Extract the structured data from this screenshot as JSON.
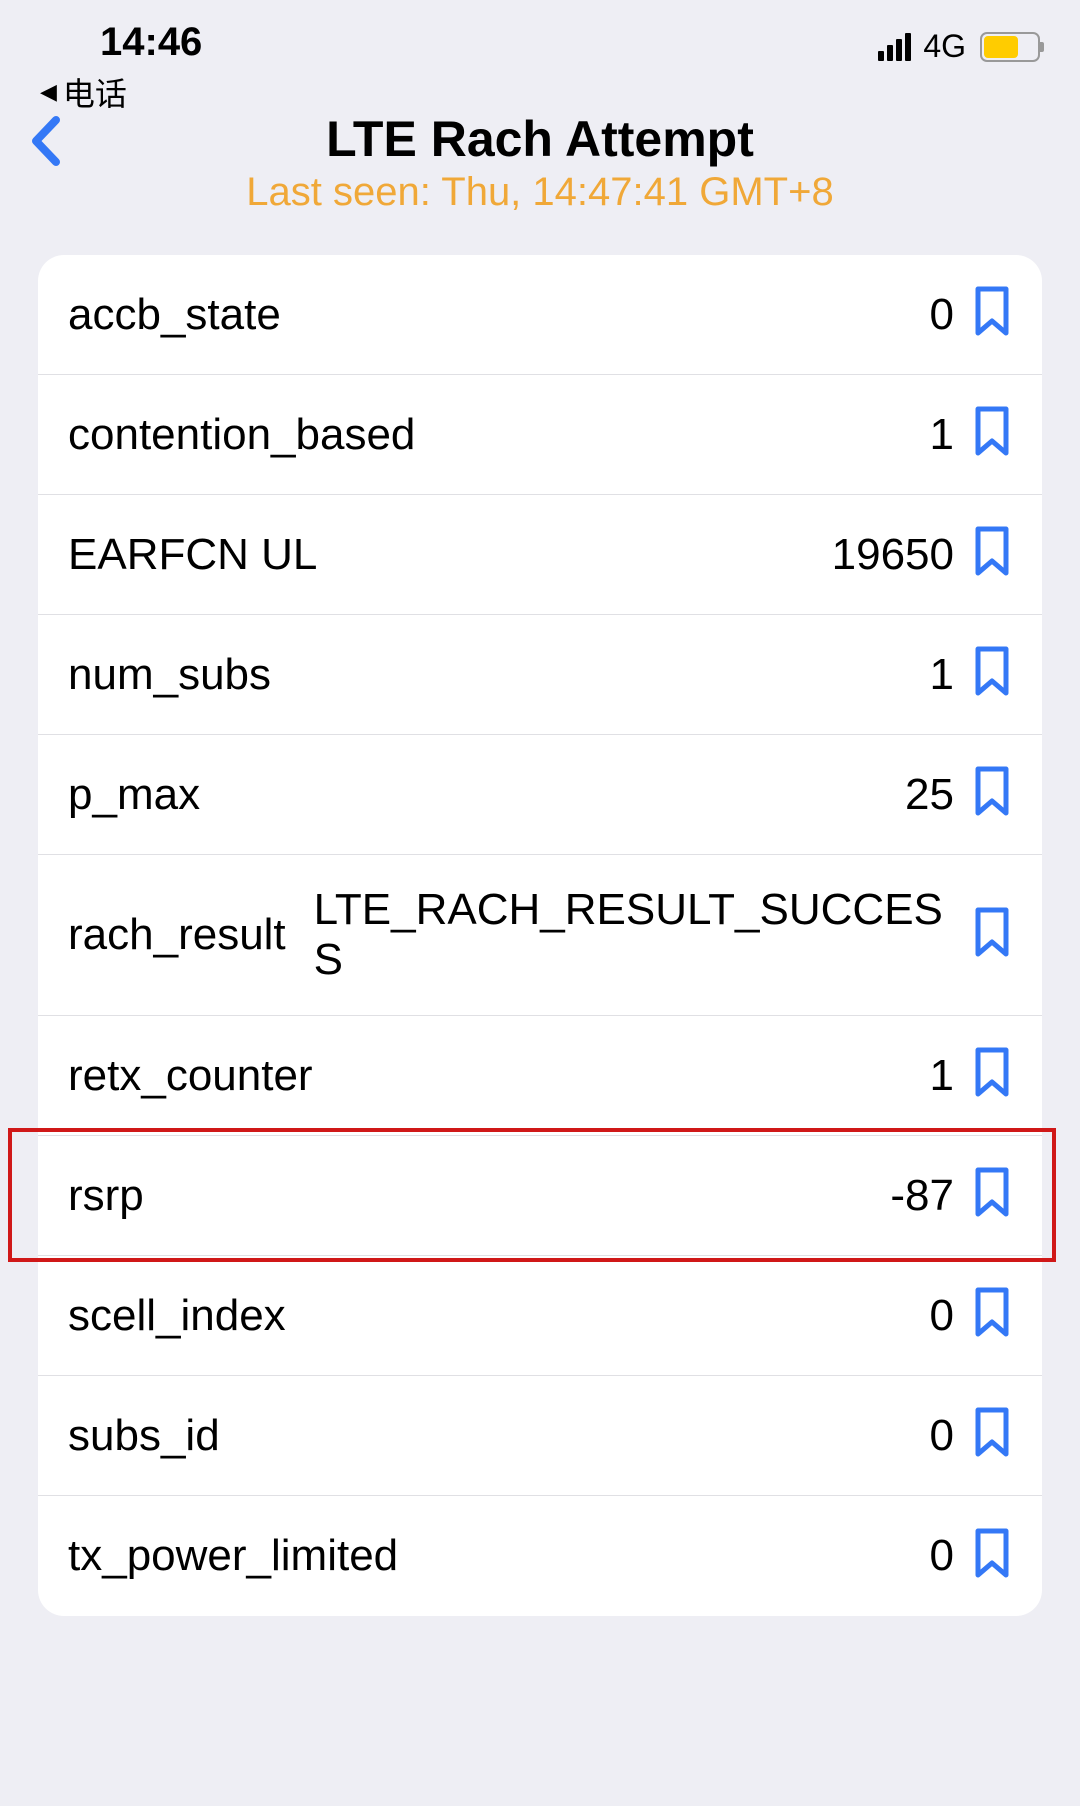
{
  "status_bar": {
    "time": "14:46",
    "back_app_arrow": "◀",
    "back_app_label": "电话",
    "network": "4G"
  },
  "header": {
    "title": "LTE Rach Attempt",
    "subtitle": "Last seen: Thu, 14:47:41 GMT+8"
  },
  "items": [
    {
      "label": "accb_state",
      "value": "0"
    },
    {
      "label": "contention_based",
      "value": "1"
    },
    {
      "label": "EARFCN UL",
      "value": "19650"
    },
    {
      "label": "num_subs",
      "value": "1"
    },
    {
      "label": "p_max",
      "value": "25"
    },
    {
      "label": "rach_result",
      "value": "LTE_RACH_RESULT_SUCCESS"
    },
    {
      "label": "retx_counter",
      "value": "1"
    },
    {
      "label": "rsrp",
      "value": "-87"
    },
    {
      "label": "scell_index",
      "value": "0"
    },
    {
      "label": "subs_id",
      "value": "0"
    },
    {
      "label": "tx_power_limited",
      "value": "0"
    }
  ],
  "colors": {
    "accent_blue": "#3478f6",
    "accent_orange": "#f0a838",
    "highlight_red": "#d01818"
  }
}
